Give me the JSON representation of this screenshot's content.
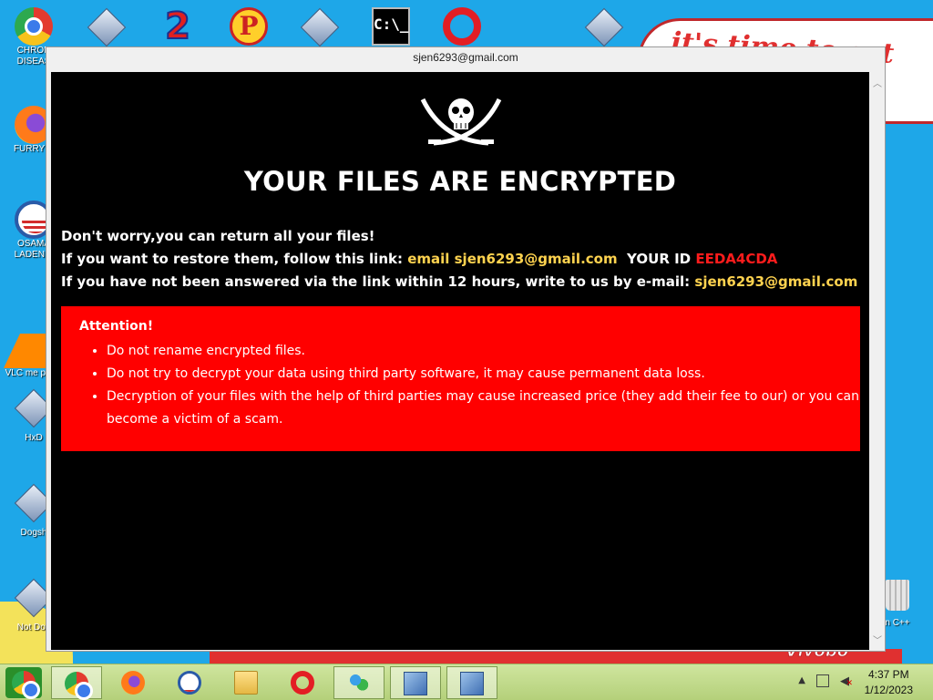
{
  "desktop": {
    "wallpaper_text": "it's time to eat shi ew",
    "wallpaper_logo": "Vivobo",
    "icons": [
      {
        "label": "CHRON DISEAS",
        "icon": "chrome-icon"
      },
      {
        "label": "FURRY C",
        "icon": "firefox-icon"
      },
      {
        "label": "OSAMA LADEN B",
        "icon": "obama-icon"
      },
      {
        "label": "VLC me playe",
        "icon": "vlc-icon"
      },
      {
        "label": "HxD",
        "icon": "hxd-icon"
      },
      {
        "label": "Dogsh",
        "icon": "file-icon"
      },
      {
        "label": "Not Dog",
        "icon": "file-icon"
      },
      {
        "label": "n C++",
        "icon": "recycle-bin-icon"
      }
    ],
    "top_icons": [
      "file-icon",
      "number-two-icon",
      "p-icon",
      "file-icon",
      "cmd-icon",
      "opera-icon",
      "file-icon"
    ],
    "cmd_text": "C:\\_"
  },
  "window": {
    "title": "sjen6293@gmail.com",
    "headline": "YOUR FILES ARE ENCRYPTED",
    "line1": "Don't worry,you can return all your files!",
    "line2_prefix": "If you want to restore them, follow this link: ",
    "line2_email": "email sjen6293@gmail.com",
    "line2_id_label": "  YOUR ID ",
    "line2_id": "EEDA4CDA",
    "line3_prefix": "If you have not been answered via the link within 12 hours, write to us by e-mail: ",
    "line3_email": "sjen6293@gmail.com",
    "attention": {
      "title": "Attention!",
      "items": [
        "Do not rename encrypted files.",
        "Do not try to decrypt your data using third party software, it may cause permanent data loss.",
        "Decryption of your files with the help of third parties may cause increased price (they add their fee to our) or you can become a victim of a scam."
      ]
    },
    "colors": {
      "background": "#000000",
      "attention_bg": "#ff0000",
      "highlight": "#ffd34f",
      "id_color": "#ff1c1c"
    }
  },
  "taskbar": {
    "buttons": [
      "start-icon",
      "chrome-icon",
      "firefox-icon",
      "obama-icon",
      "folder-icon",
      "opera-icon",
      "people-icon",
      "setup-icon",
      "setup-icon"
    ],
    "clock_time": "4:37 PM",
    "clock_date": "1/12/2023"
  }
}
